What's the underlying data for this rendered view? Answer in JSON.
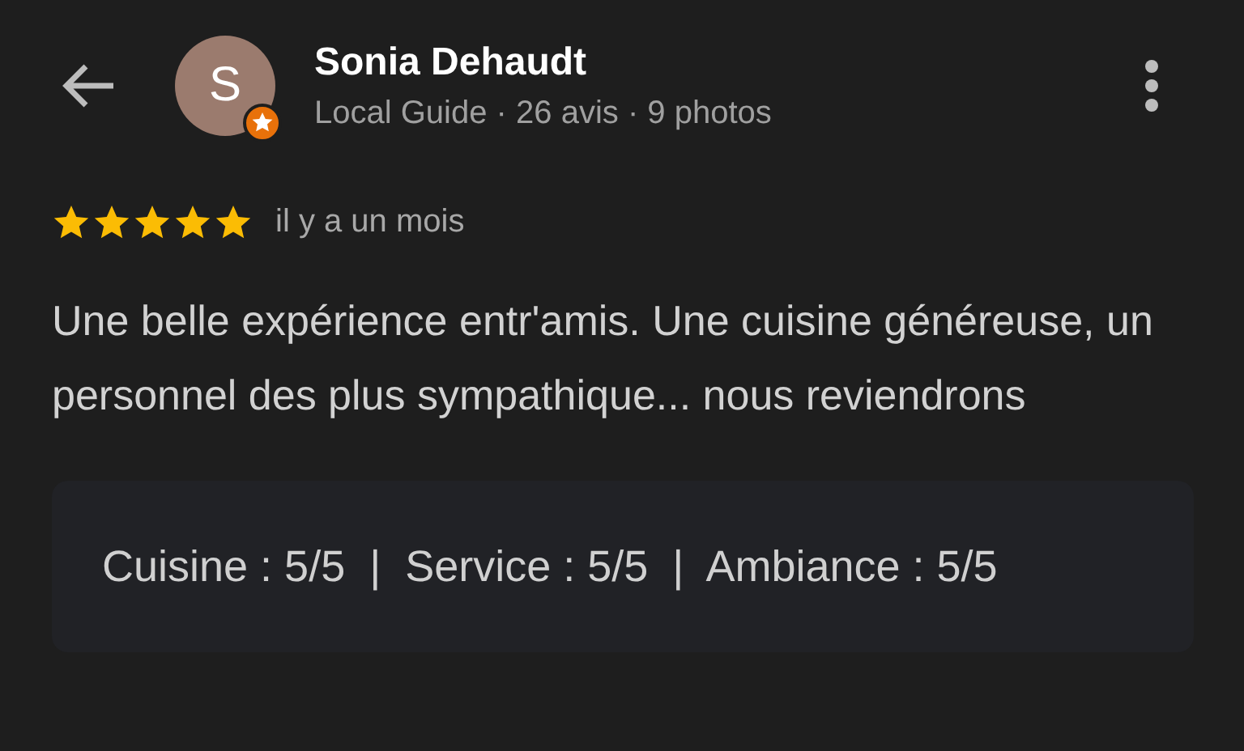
{
  "reviewer": {
    "initial": "S",
    "name": "Sonia Dehaudt",
    "meta": "Local Guide · 26 avis · 9 photos",
    "local_guide": true
  },
  "review": {
    "stars": 5,
    "time": "il y a un mois",
    "text": "Une belle expérience entr'amis. Une cuisine généreuse, un personnel des plus sympathique... nous reviendrons",
    "ratings": "Cuisine : 5/5  |  Service : 5/5  |  Ambiance : 5/5"
  }
}
